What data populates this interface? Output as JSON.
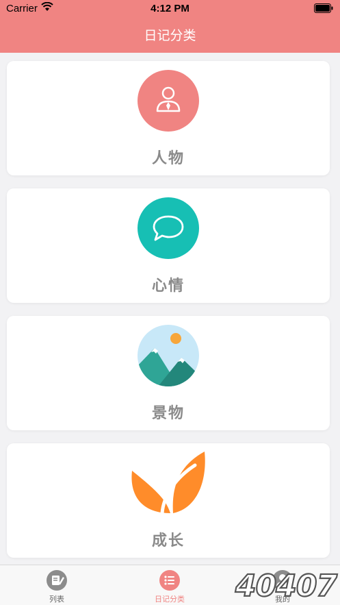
{
  "status": {
    "carrier": "Carrier",
    "time": "4:12 PM"
  },
  "nav": {
    "title": "日记分类"
  },
  "categories": [
    {
      "label": "人物",
      "icon": "person-icon",
      "color": "#f08482"
    },
    {
      "label": "心情",
      "icon": "chat-bubble-icon",
      "color": "#17bfb4"
    },
    {
      "label": "景物",
      "icon": "landscape-icon",
      "color": "#c8e8f8"
    },
    {
      "label": "成长",
      "icon": "leaf-icon",
      "color": "#ff8c2a"
    }
  ],
  "tabs": [
    {
      "label": "列表",
      "icon": "list-edit-icon",
      "active": false
    },
    {
      "label": "日记分类",
      "icon": "category-list-icon",
      "active": true
    },
    {
      "label": "我的",
      "icon": "user-icon",
      "active": false
    }
  ],
  "watermark": {
    "text": "40407"
  },
  "colors": {
    "accent": "#f08482",
    "background": "#f2f2f4"
  }
}
